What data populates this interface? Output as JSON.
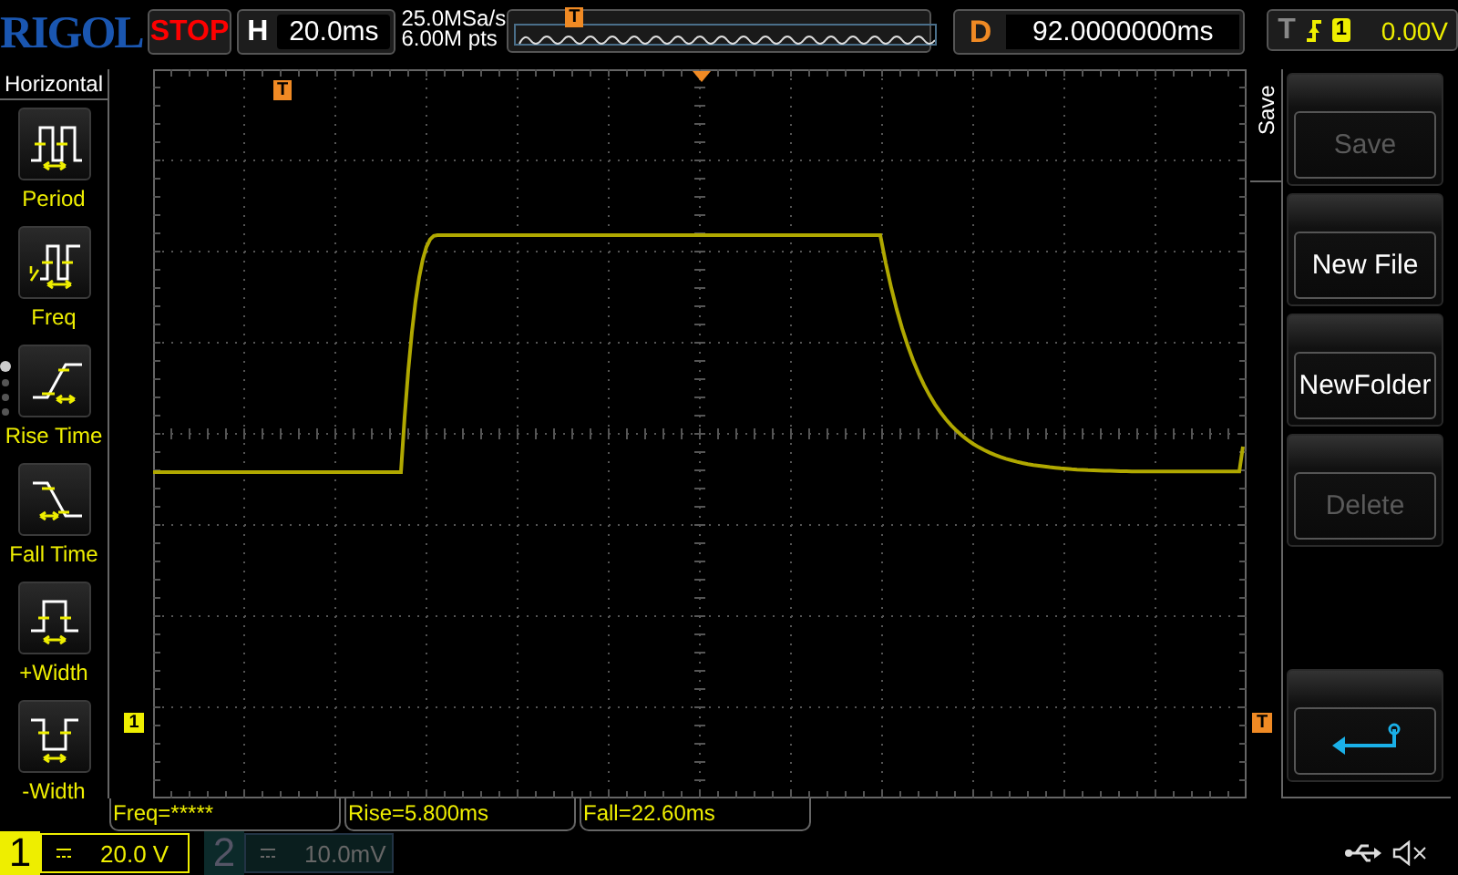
{
  "brand": "RIGOL",
  "run_status": {
    "label": "STOP"
  },
  "horizontal": {
    "label": "H",
    "timebase": "20.0ms"
  },
  "acquisition": {
    "sample_rate": "25.0MSa/s",
    "memory_depth": "6.00M pts",
    "trigger_marker": "T"
  },
  "delay": {
    "label": "D",
    "value": "92.0000000ms"
  },
  "trigger": {
    "label": "T",
    "source": "1",
    "level": "0.00V"
  },
  "measure_menu": {
    "title": "Horizontal",
    "items": [
      {
        "label": "Period",
        "kind": "period"
      },
      {
        "label": "Freq",
        "kind": "freq"
      },
      {
        "label": "Rise Time",
        "kind": "rise"
      },
      {
        "label": "Fall Time",
        "kind": "fall"
      },
      {
        "label": "+Width",
        "kind": "pwidth"
      },
      {
        "label": "-Width",
        "kind": "nwidth"
      }
    ],
    "pages": [
      {
        "selected": true
      },
      {
        "selected": false
      },
      {
        "selected": false
      },
      {
        "selected": false
      }
    ]
  },
  "scope": {
    "trigger_position_marker": "T",
    "channel_marker": "1",
    "trigger_level_marker": "T"
  },
  "softkey_menu": {
    "title": "Save",
    "buttons": [
      {
        "kind": "text",
        "label": "Save",
        "disabled": true
      },
      {
        "kind": "text",
        "label": "New File",
        "disabled": false
      },
      {
        "kind": "text",
        "label": "NewFolder",
        "disabled": false
      },
      {
        "kind": "text",
        "label": "Delete",
        "disabled": true
      },
      {
        "kind": "back"
      }
    ]
  },
  "measurements": [
    "Freq=*****",
    "Rise=5.800ms",
    "Fall=22.60ms"
  ],
  "channels": [
    {
      "number": "1",
      "scale": "20.0 V",
      "on": true
    },
    {
      "number": "2",
      "scale": "10.0mV",
      "on": false
    }
  ]
}
